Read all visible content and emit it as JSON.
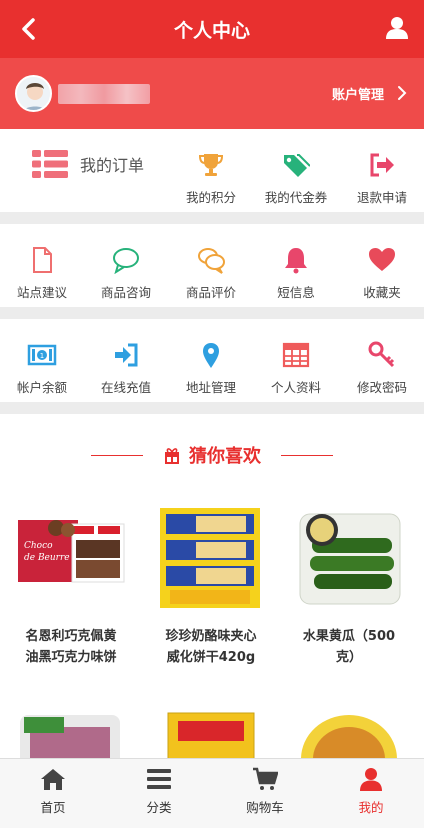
{
  "header": {
    "title": "个人中心",
    "back_icon": "chevron-left-icon",
    "user_icon": "user-icon"
  },
  "account": {
    "manage_label": "账户管理"
  },
  "orders": {
    "main_label": "我的订单",
    "items": [
      {
        "label": "我的积分",
        "icon": "trophy-icon",
        "color": "#f0a33a"
      },
      {
        "label": "我的代金券",
        "icon": "tags-icon",
        "color": "#27b27b"
      },
      {
        "label": "退款申请",
        "icon": "sign-out-icon",
        "color": "#e8466b"
      }
    ]
  },
  "services": [
    {
      "label": "站点建议",
      "icon": "file-icon",
      "color": "#ef6f6f"
    },
    {
      "label": "商品咨询",
      "icon": "comment-icon",
      "color": "#27b27b"
    },
    {
      "label": "商品评价",
      "icon": "comments-icon",
      "color": "#f0a33a"
    },
    {
      "label": "短信息",
      "icon": "bell-icon",
      "color": "#e8466b"
    },
    {
      "label": "收藏夹",
      "icon": "heart-icon",
      "color": "#e84a5a"
    }
  ],
  "tools": [
    {
      "label": "帐户余额",
      "icon": "money-icon",
      "color": "#2e9fe0"
    },
    {
      "label": "在线充值",
      "icon": "sign-in-icon",
      "color": "#2e9fe0"
    },
    {
      "label": "地址管理",
      "icon": "map-marker-icon",
      "color": "#2e9fe0"
    },
    {
      "label": "个人资料",
      "icon": "table-icon",
      "color": "#ef5b5b"
    },
    {
      "label": "修改密码",
      "icon": "key-icon",
      "color": "#e8466b"
    }
  ],
  "guess": {
    "title": "猜你喜欢",
    "products": [
      {
        "name_line1": "名恩利巧克佩黄",
        "name_line2": "油黑巧克力味饼"
      },
      {
        "name_line1": "珍珍奶酪味夹心",
        "name_line2": "威化饼干420g"
      },
      {
        "name_line1": "水果黄瓜（500",
        "name_line2": "克）"
      }
    ]
  },
  "tabbar": [
    {
      "label": "首页",
      "icon": "home-icon"
    },
    {
      "label": "分类",
      "icon": "bars-icon"
    },
    {
      "label": "购物车",
      "icon": "cart-icon"
    },
    {
      "label": "我的",
      "icon": "user-icon",
      "active": true
    }
  ],
  "colors": {
    "primary": "#e8302f",
    "account_bg": "#ef4b4a"
  }
}
